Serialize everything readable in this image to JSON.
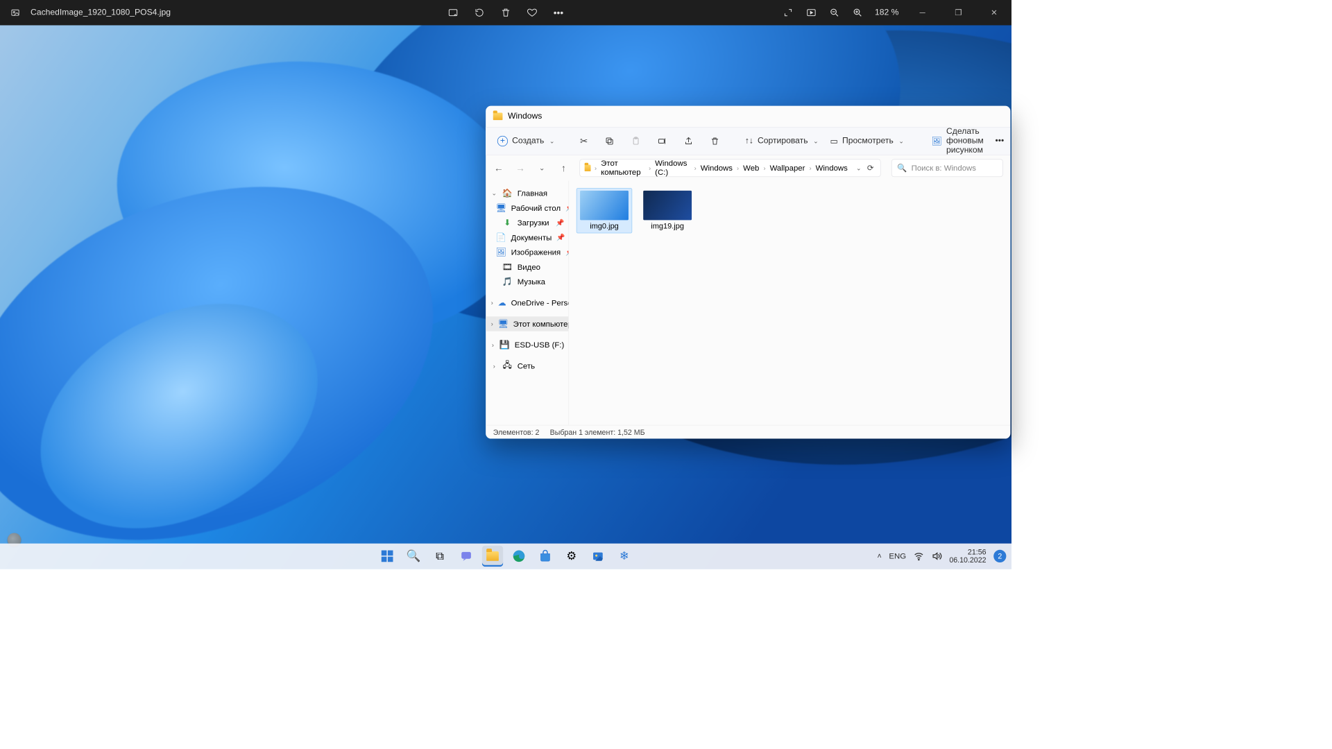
{
  "photos": {
    "filename": "CachedImage_1920_1080_POS4.jpg",
    "zoom": "182 %"
  },
  "explorer": {
    "title": "Windows",
    "toolbar": {
      "create": "Создать",
      "sort": "Сортировать",
      "view": "Просмотреть",
      "setbg": "Сделать фоновым рисунком"
    },
    "breadcrumb": [
      "Этот компьютер",
      "Windows (C:)",
      "Windows",
      "Web",
      "Wallpaper",
      "Windows"
    ],
    "search_placeholder": "Поиск в: Windows",
    "sidebar": {
      "home": "Главная",
      "desktop": "Рабочий стол",
      "downloads": "Загрузки",
      "documents": "Документы",
      "pictures": "Изображения",
      "videos": "Видео",
      "music": "Музыка",
      "onedrive": "OneDrive - Personal",
      "thispc": "Этот компьютер",
      "esd": "ESD-USB (F:)",
      "network": "Сеть"
    },
    "files": [
      "img0.jpg",
      "img19.jpg"
    ],
    "status": {
      "count": "Элементов: 2",
      "sel": "Выбран 1 элемент: 1,52 МБ"
    }
  },
  "tray": {
    "lang": "ENG",
    "time": "21:56",
    "date": "06.10.2022",
    "notif": "2"
  }
}
